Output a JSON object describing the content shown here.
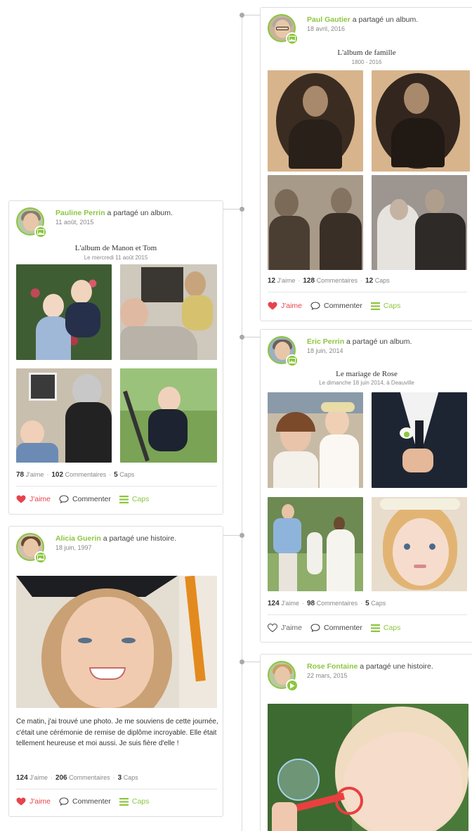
{
  "colors": {
    "accent_green": "#8cc63f",
    "like_red": "#e8434c",
    "timeline_gray": "#d9d9d9"
  },
  "icons": {
    "like": "heart-icon",
    "comment": "speech-bubble-icon",
    "caps": "list-icon",
    "album_badge": "image-icon",
    "story_badge": "story-icon"
  },
  "posts": [
    {
      "author": "Paul Gautier",
      "action": " a partagé un album.",
      "date": "18 avril, 2016",
      "album_title": "L'album de famille",
      "album_subtitle": "1800 - 2016",
      "likes": "12",
      "likes_label": "J'aime",
      "comments": "128",
      "comments_label": "Commentaires",
      "caps": "12",
      "caps_label": "Caps",
      "like_action": "J'aime",
      "comment_action": "Commenter",
      "caps_action": "Caps",
      "liked": true
    },
    {
      "author": "Pauline Perrin",
      "action": " a partagé un album.",
      "date": "11 août, 2015",
      "album_title": "L'album de Manon et Tom",
      "album_subtitle": "Le mercredi 11 août 2015",
      "likes": "78",
      "likes_label": "J'aime",
      "comments": "102",
      "comments_label": "Commentaires",
      "caps": "5",
      "caps_label": "Caps",
      "like_action": "J'aime",
      "comment_action": "Commenter",
      "caps_action": "Caps",
      "liked": true
    },
    {
      "author": "Eric Perrin",
      "action": " a partagé un album.",
      "date": "18 juin, 2014",
      "album_title": "Le mariage de Rose",
      "album_subtitle": "Le dimanche 18 juin 2014, à Deauville",
      "likes": "124",
      "likes_label": "J'aime",
      "comments": "98",
      "comments_label": "Commentaires",
      "caps": "5",
      "caps_label": "Caps",
      "like_action": "J'aime",
      "comment_action": "Commenter",
      "caps_action": "Caps",
      "liked": false
    },
    {
      "author": "Alicia Guerin",
      "action": " a partagé une histoire.",
      "date": "18 juin, 1997",
      "story": "Ce matin, j'ai trouvé une photo. Je me souviens de cette journée, c'était une cérémonie de remise de diplôme incroyable. Elle était tellement heureuse et moi aussi. Je suis fière d'elle !",
      "likes": "124",
      "likes_label": "J'aime",
      "comments": "206",
      "comments_label": "Commentaires",
      "caps": "3",
      "caps_label": "Caps",
      "like_action": "J'aime",
      "comment_action": "Commenter",
      "caps_action": "Caps",
      "liked": true
    },
    {
      "author": "Rose Fontaine",
      "action": " a partagé une histoire.",
      "date": "22 mars, 2015"
    }
  ]
}
